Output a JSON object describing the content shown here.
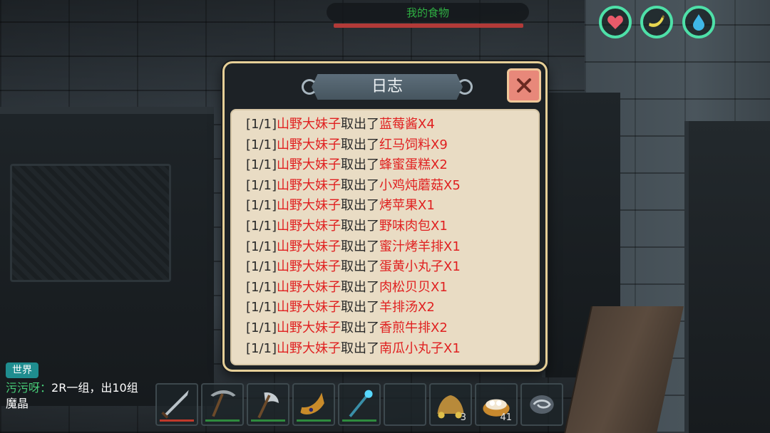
{
  "hud": {
    "food_title": "我的食物",
    "food_level": 1.0,
    "stats": [
      {
        "name": "health",
        "icon": "heart-icon"
      },
      {
        "name": "hunger",
        "icon": "banana-icon"
      },
      {
        "name": "thirst",
        "icon": "water-drop-icon"
      }
    ],
    "colors": {
      "stat_ring": "#4ee0a8",
      "food_bar": "#b23a38",
      "food_text": "#2fb043"
    }
  },
  "dialog": {
    "title": "日志",
    "close_icon": "close-icon",
    "entries": [
      {
        "idx": "[1/1]",
        "name": "山野大妹子",
        "action": "取出了",
        "item": "蓝莓酱X4"
      },
      {
        "idx": "[1/1]",
        "name": "山野大妹子",
        "action": "取出了",
        "item": "红马饲料X9"
      },
      {
        "idx": "[1/1]",
        "name": "山野大妹子",
        "action": "取出了",
        "item": "蜂蜜蛋糕X2"
      },
      {
        "idx": "[1/1]",
        "name": "山野大妹子",
        "action": "取出了",
        "item": "小鸡炖蘑菇X5"
      },
      {
        "idx": "[1/1]",
        "name": "山野大妹子",
        "action": "取出了",
        "item": "烤苹果X1"
      },
      {
        "idx": "[1/1]",
        "name": "山野大妹子",
        "action": "取出了",
        "item": "野味肉包X1"
      },
      {
        "idx": "[1/1]",
        "name": "山野大妹子",
        "action": "取出了",
        "item": "蜜汁烤羊排X1"
      },
      {
        "idx": "[1/1]",
        "name": "山野大妹子",
        "action": "取出了",
        "item": "蛋黄小丸子X1"
      },
      {
        "idx": "[1/1]",
        "name": "山野大妹子",
        "action": "取出了",
        "item": "肉松贝贝X1"
      },
      {
        "idx": "[1/1]",
        "name": "山野大妹子",
        "action": "取出了",
        "item": "羊排汤X2"
      },
      {
        "idx": "[1/1]",
        "name": "山野大妹子",
        "action": "取出了",
        "item": "香煎牛排X2"
      },
      {
        "idx": "[1/1]",
        "name": "山野大妹子",
        "action": "取出了",
        "item": "南瓜小丸子X1"
      }
    ]
  },
  "chat": {
    "channel": "世界",
    "user": "污污呀",
    "separator": "：",
    "message": "2R一组，出10组魔晶"
  },
  "hotbar": [
    {
      "icon": "sword-icon",
      "count": "",
      "durability_color": "#c0392b"
    },
    {
      "icon": "pickaxe-icon",
      "count": "",
      "durability_color": "#2e8b3e"
    },
    {
      "icon": "axe-icon",
      "count": "",
      "durability_color": "#2e8b3e"
    },
    {
      "icon": "horn-icon",
      "count": "",
      "durability_color": "#2e8b3e"
    },
    {
      "icon": "staff-icon",
      "count": "",
      "durability_color": "#2e8b3e"
    },
    {
      "icon": "empty-slot-icon",
      "count": "",
      "durability_color": ""
    },
    {
      "icon": "gold-pile-icon",
      "count": "3",
      "durability_color": ""
    },
    {
      "icon": "dumpling-bowl-icon",
      "count": "41",
      "durability_color": ""
    },
    {
      "icon": "swirl-stone-icon",
      "count": "",
      "durability_color": ""
    }
  ]
}
